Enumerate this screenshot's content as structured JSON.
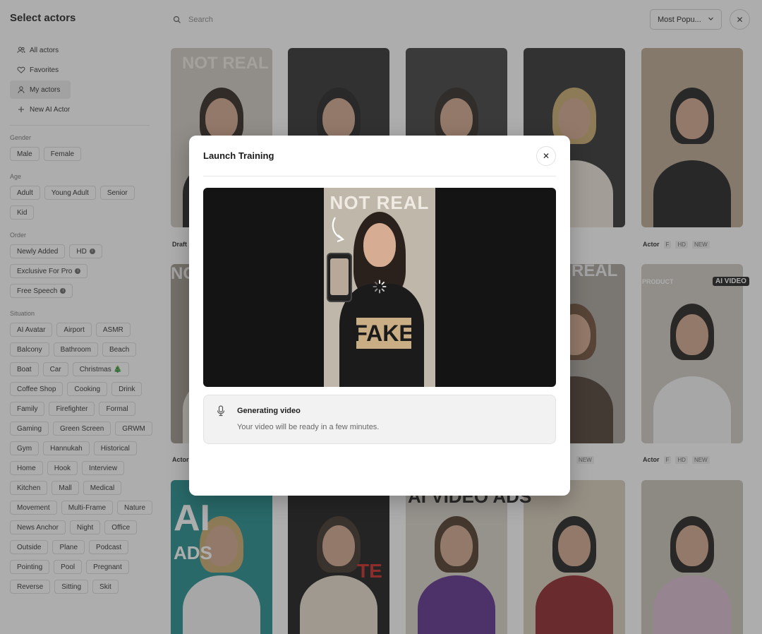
{
  "sidebar": {
    "title": "Select actors",
    "nav": [
      {
        "label": "All actors",
        "icon": "users-icon"
      },
      {
        "label": "Favorites",
        "icon": "heart-icon"
      },
      {
        "label": "My actors",
        "icon": "user-icon",
        "active": true
      },
      {
        "label": "New AI Actor",
        "icon": "plus-icon"
      }
    ],
    "filters": {
      "gender": {
        "title": "Gender",
        "options": [
          "Male",
          "Female"
        ]
      },
      "age": {
        "title": "Age",
        "options": [
          "Adult",
          "Young Adult",
          "Senior",
          "Kid"
        ]
      },
      "order": {
        "title": "Order",
        "options": [
          "Newly Added",
          "HD",
          "Exclusive For Pro",
          "Free Speech"
        ]
      },
      "situation": {
        "title": "Situation",
        "options": [
          "AI Avatar",
          "Airport",
          "ASMR",
          "Balcony",
          "Bathroom",
          "Beach",
          "Boat",
          "Car",
          "Christmas 🎄",
          "Coffee Shop",
          "Cooking",
          "Drink",
          "Family",
          "Firefighter",
          "Formal",
          "Gaming",
          "Green Screen",
          "GRWM",
          "Gym",
          "Hannukah",
          "Historical",
          "Home",
          "Hook",
          "Interview",
          "Kitchen",
          "Mall",
          "Medical",
          "Movement",
          "Multi-Frame",
          "Nature",
          "News Anchor",
          "Night",
          "Office",
          "Outside",
          "Plane",
          "Podcast",
          "Pointing",
          "Pool",
          "Pregnant",
          "Reverse",
          "Sitting",
          "Skit"
        ]
      }
    }
  },
  "header": {
    "search_placeholder": "Search",
    "sort_selected": "Most Popu...",
    "close_label": "✕"
  },
  "grid": {
    "card_labels": {
      "draft": "Draft",
      "actor": "Actor",
      "tag_f": "F",
      "tag_hd": "HD",
      "tag_new": "NEW"
    },
    "thumb_text": {
      "not_real": "NOT REAL",
      "ai_video": "AI VIDEO",
      "product": "PRODUCT",
      "ai": "AI",
      "ads": "ADS",
      "ai_video_ads": "AI VIDEO ADS",
      "real": "REAL",
      "no": "NO",
      "ted": "TE"
    }
  },
  "modal": {
    "title": "Launch Training",
    "close_label": "✕",
    "video": {
      "banner": "NOT REAL",
      "shirt": "FAKE"
    },
    "status": {
      "icon": "microphone-icon",
      "title": "Generating video",
      "subtitle": "Your video will be ready in a few minutes."
    }
  },
  "colors": {
    "overlay": "#3c3c3c",
    "modal_bg": "#ffffff",
    "video_bg": "#141414",
    "status_bg": "#f2f2f2"
  }
}
